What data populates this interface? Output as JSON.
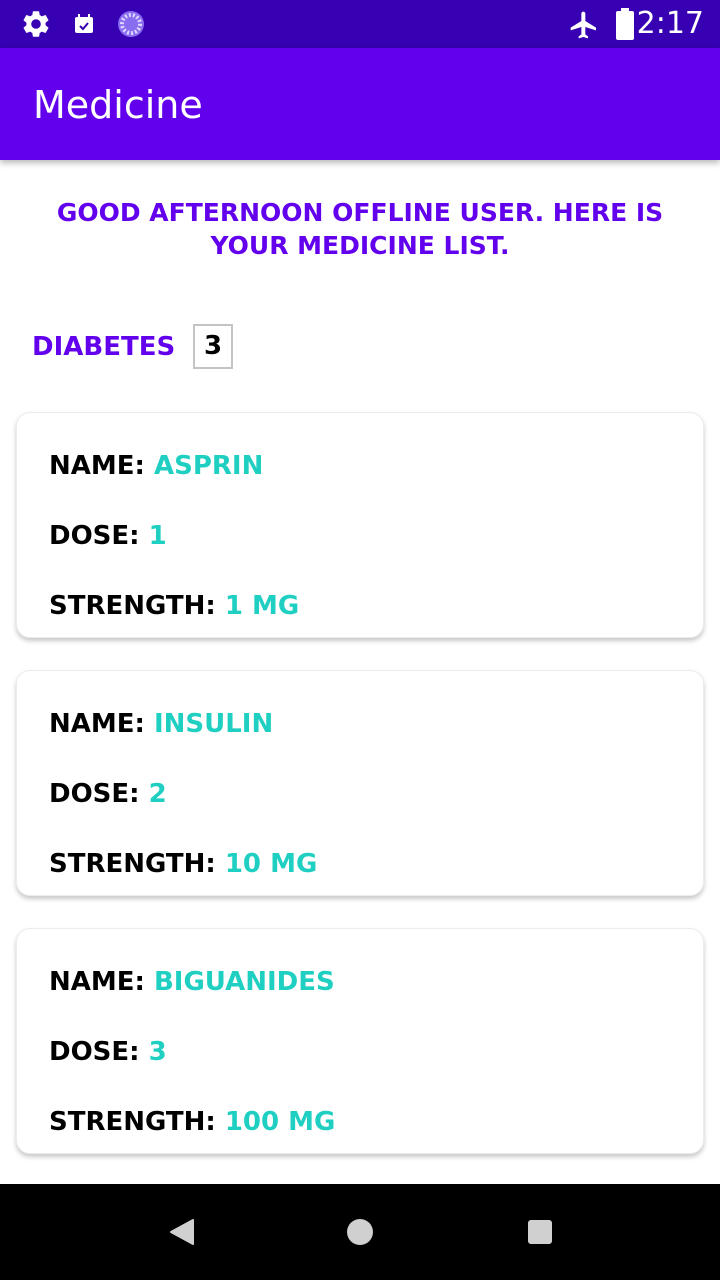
{
  "status_bar": {
    "time": "2:17",
    "icons_left": [
      "settings-icon",
      "calendar-icon",
      "loading-spinner-icon"
    ],
    "icons_right": [
      "airplane-mode-icon",
      "battery-icon"
    ]
  },
  "app_bar": {
    "title": "Medicine"
  },
  "greeting": "GOOD AFTERNOON OFFLINE USER. HERE IS YOUR MEDICINE LIST.",
  "category": {
    "label": "DIABETES",
    "count": "3"
  },
  "labels": {
    "name": "NAME: ",
    "dose": "DOSE: ",
    "strength": "STRENGTH: "
  },
  "medicines": [
    {
      "name": "ASPRIN",
      "dose": "1",
      "strength": "1 MG"
    },
    {
      "name": "INSULIN",
      "dose": "2",
      "strength": "10 MG"
    },
    {
      "name": "BIGUANIDES",
      "dose": "3",
      "strength": "100 MG"
    }
  ],
  "nav_bar": {
    "buttons": [
      "back-icon",
      "home-icon",
      "recents-icon"
    ]
  },
  "colors": {
    "status_bar": "#3700b3",
    "primary": "#6200ee",
    "accent_value": "#1fcfc1"
  }
}
